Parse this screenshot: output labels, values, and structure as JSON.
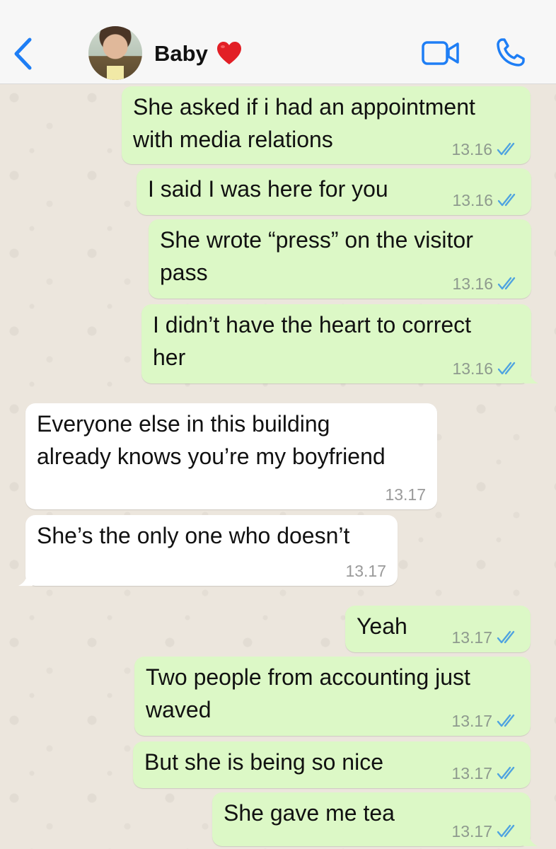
{
  "header": {
    "contact_name": "Baby",
    "heart_emoji": "❤️",
    "icons": {
      "back": "chevron-left-icon",
      "video": "video-camera-icon",
      "call": "phone-icon"
    },
    "accent_color": "#1e7ef5"
  },
  "messages": [
    {
      "direction": "out",
      "lines": [
        "She asked if i had an appointment",
        "with media relations"
      ],
      "time": "13.16",
      "read": true
    },
    {
      "direction": "out",
      "lines": [
        "I said I was here for you"
      ],
      "time": "13.16",
      "read": true
    },
    {
      "direction": "out",
      "lines": [
        "She wrote “press” on the visitor",
        "pass"
      ],
      "time": "13.16",
      "read": true
    },
    {
      "direction": "out",
      "lines": [
        "I didn’t have the heart to correct",
        "her"
      ],
      "time": "13.16",
      "read": true
    },
    {
      "direction": "in",
      "lines": [
        "Everyone else in this building",
        "already knows you’re my boyfriend"
      ],
      "time": "13.17"
    },
    {
      "direction": "in",
      "lines": [
        "She’s the only one who doesn’t"
      ],
      "time": "13.17"
    },
    {
      "direction": "out",
      "lines": [
        "Yeah"
      ],
      "time": "13.17",
      "read": true
    },
    {
      "direction": "out",
      "lines": [
        "Two people from accounting just",
        "waved"
      ],
      "time": "13.17",
      "read": true
    },
    {
      "direction": "out",
      "lines": [
        "But she is being so nice"
      ],
      "time": "13.17",
      "read": true
    },
    {
      "direction": "out",
      "lines": [
        "She gave me tea"
      ],
      "time": "13.17",
      "read": true
    }
  ],
  "colors": {
    "outgoing_bubble": "#dcf8c6",
    "incoming_bubble": "#ffffff",
    "read_ticks": "#4fa3e0"
  }
}
